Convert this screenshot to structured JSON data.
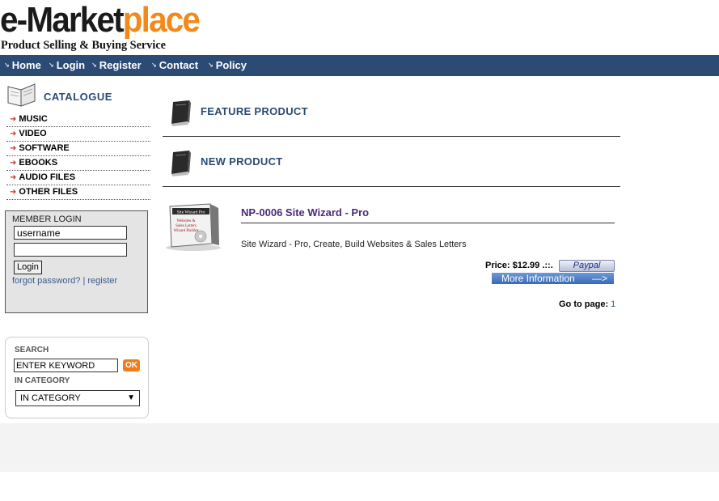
{
  "logo": {
    "part1": "e-Market",
    "part2": "place",
    "tagline": "Product Selling & Buying Service"
  },
  "nav": {
    "items": [
      "Home",
      "Login",
      "Register",
      "Contact",
      "Policy"
    ]
  },
  "catalogue": {
    "title": "CATALOGUE",
    "items": [
      "MUSIC",
      "VIDEO",
      "SOFTWARE",
      "EBOOKS",
      "AUDIO FILES",
      "OTHER FILES"
    ]
  },
  "login": {
    "title": "MEMBER LOGIN",
    "username_value": "username",
    "password_value": "",
    "button_label": "Login",
    "forgot_label": "forgot password?",
    "separator": "|",
    "register_label": "register"
  },
  "search": {
    "label": "SEARCH",
    "keyword_value": "ENTER KEYWORD",
    "ok_label": "OK",
    "category_label": "IN CATEGORY",
    "category_selected": "IN CATEGORY"
  },
  "sections": {
    "feature_title": "FEATURE PRODUCT",
    "new_title": "NEW PRODUCT"
  },
  "product": {
    "box_lines": [
      "Site Wizard Pro",
      "Websites &",
      "Sales Letters",
      "Wizard Builder"
    ],
    "name": "NP-0006 Site Wizard - Pro",
    "description": "Site Wizard - Pro, Create, Build Websites & Sales Letters",
    "price": "Price: $12.99 .::.",
    "paypal_label": "Paypal",
    "more_info_label": "More Information"
  },
  "pagination": {
    "label": "Go to page:",
    "pages": [
      "1"
    ]
  },
  "colors": {
    "nav_bg": "#2b4a74",
    "logo_accent": "#f28a1a",
    "ok_button": "#f07d1a"
  }
}
